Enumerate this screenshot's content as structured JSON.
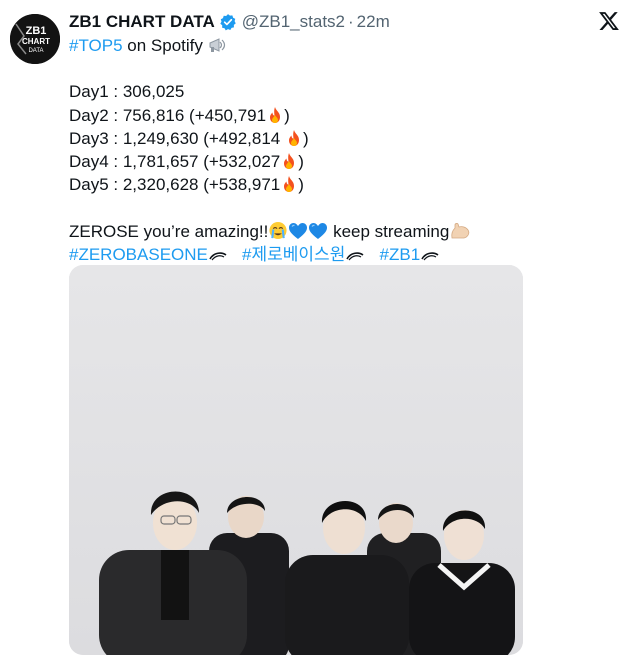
{
  "tweet": {
    "display_name": "ZB1 CHART DATA",
    "handle": "@ZB1_stats2",
    "separator": "·",
    "time": "22m",
    "avatar_text": {
      "line1": "ZB1",
      "line2": "CHART",
      "line3": "DATA"
    },
    "headline": {
      "hashtag": "#TOP5",
      "rest": " on Spotify "
    },
    "days": [
      {
        "label": "Day1 : 306,025",
        "gain": "",
        "fire": false
      },
      {
        "label": "Day2 : 756,816 ",
        "gain": "(+450,791",
        "close": ")",
        "fire": true
      },
      {
        "label": "Day3 : 1,249,630 ",
        "gain": "(+492,814 ",
        "close": ")",
        "fire": true
      },
      {
        "label": "Day4 : 1,781,657 ",
        "gain": "(+532,027",
        "close": ")",
        "fire": true
      },
      {
        "label": "Day5 : 2,320,628 ",
        "gain": "(+538,971",
        "close": ")",
        "fire": true
      }
    ],
    "closing": {
      "start": "ZEROSE you’re amazing!!",
      "end": " keep streaming"
    },
    "hashtags": [
      "#ZEROBASEONE",
      "#제로베이스원",
      "#ZB1"
    ],
    "colors": {
      "link": "#1d9bf0",
      "text": "#0f1419",
      "secondary": "#536471",
      "verified": "#1d9bf0"
    },
    "icons": {
      "verified": "verified-badge-icon",
      "close": "x-logo-icon",
      "megaphone": "megaphone-emoji",
      "fire": "fire-emoji",
      "crying": "loudly-crying-face-emoji",
      "heart": "blue-heart-emoji",
      "muscle": "flexed-biceps-emoji"
    }
  }
}
